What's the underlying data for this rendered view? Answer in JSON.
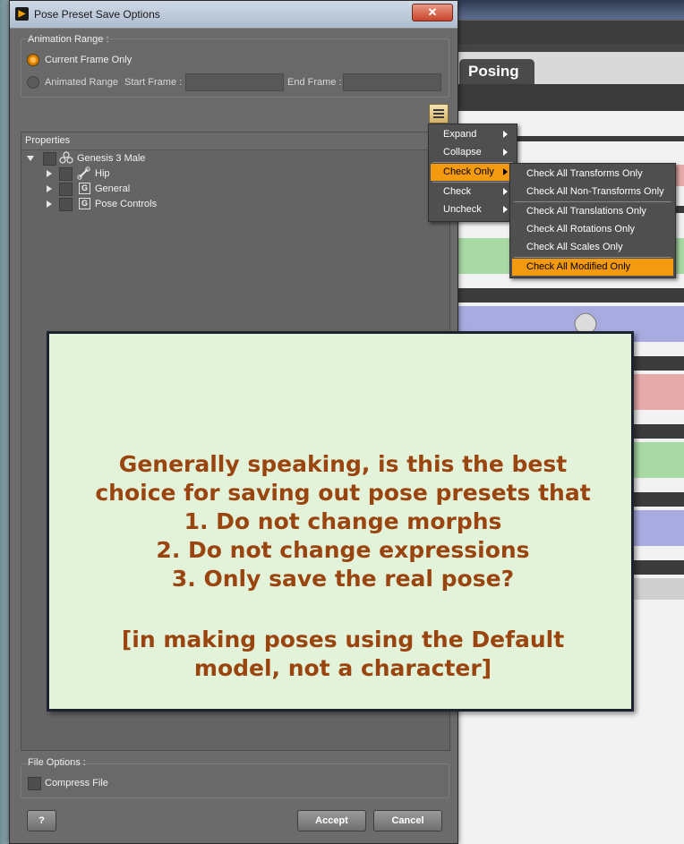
{
  "dialog": {
    "title": "Pose Preset Save Options",
    "close_label": "✕"
  },
  "animation_range": {
    "group_label": "Animation Range :",
    "current_frame_label": "Current Frame Only",
    "current_frame_selected": true,
    "animated_range_label": "Animated Range",
    "animated_range_selected": false,
    "start_frame_label": "Start Frame :",
    "start_frame_value": "",
    "end_frame_label": "End Frame :",
    "end_frame_value": ""
  },
  "properties": {
    "header": "Properties",
    "items": [
      {
        "label": "Genesis 3 Male",
        "icon": "figure-icon",
        "expanded": true
      },
      {
        "label": "Hip",
        "icon": "bone-icon"
      },
      {
        "label": "General",
        "icon": "group-icon",
        "glyph": "G"
      },
      {
        "label": "Pose Controls",
        "icon": "group-icon",
        "glyph": "G"
      }
    ]
  },
  "context_menu": {
    "items": [
      "Expand",
      "Collapse",
      "Check Only",
      "Check",
      "Uncheck"
    ],
    "highlighted": "Check Only"
  },
  "submenu": {
    "items": [
      "Check All Transforms Only",
      "Check All Non-Transforms Only",
      "Check All Translations Only",
      "Check All Rotations Only",
      "Check All Scales Only",
      "Check All Modified Only"
    ],
    "highlighted": "Check All Modified Only"
  },
  "file_options": {
    "group_label": "File Options :",
    "compress_label": "Compress File",
    "compress_checked": false
  },
  "buttons": {
    "help": "?",
    "accept": "Accept",
    "cancel": "Cancel"
  },
  "background_app": {
    "tab_label": "Posing"
  },
  "note": {
    "question": "Generally speaking, is this the best\nchoice for saving out pose presets that\n1. Do not change morphs\n2. Do not change expressions\n3. Only save the real pose?",
    "aside": "[in making poses using the Default\nmodel, not a character]"
  },
  "colors": {
    "accent": "#f39a10",
    "note_background": "#e3f3d9",
    "note_text": "#9a4510",
    "dialog_bg": "#6b6b6b"
  }
}
